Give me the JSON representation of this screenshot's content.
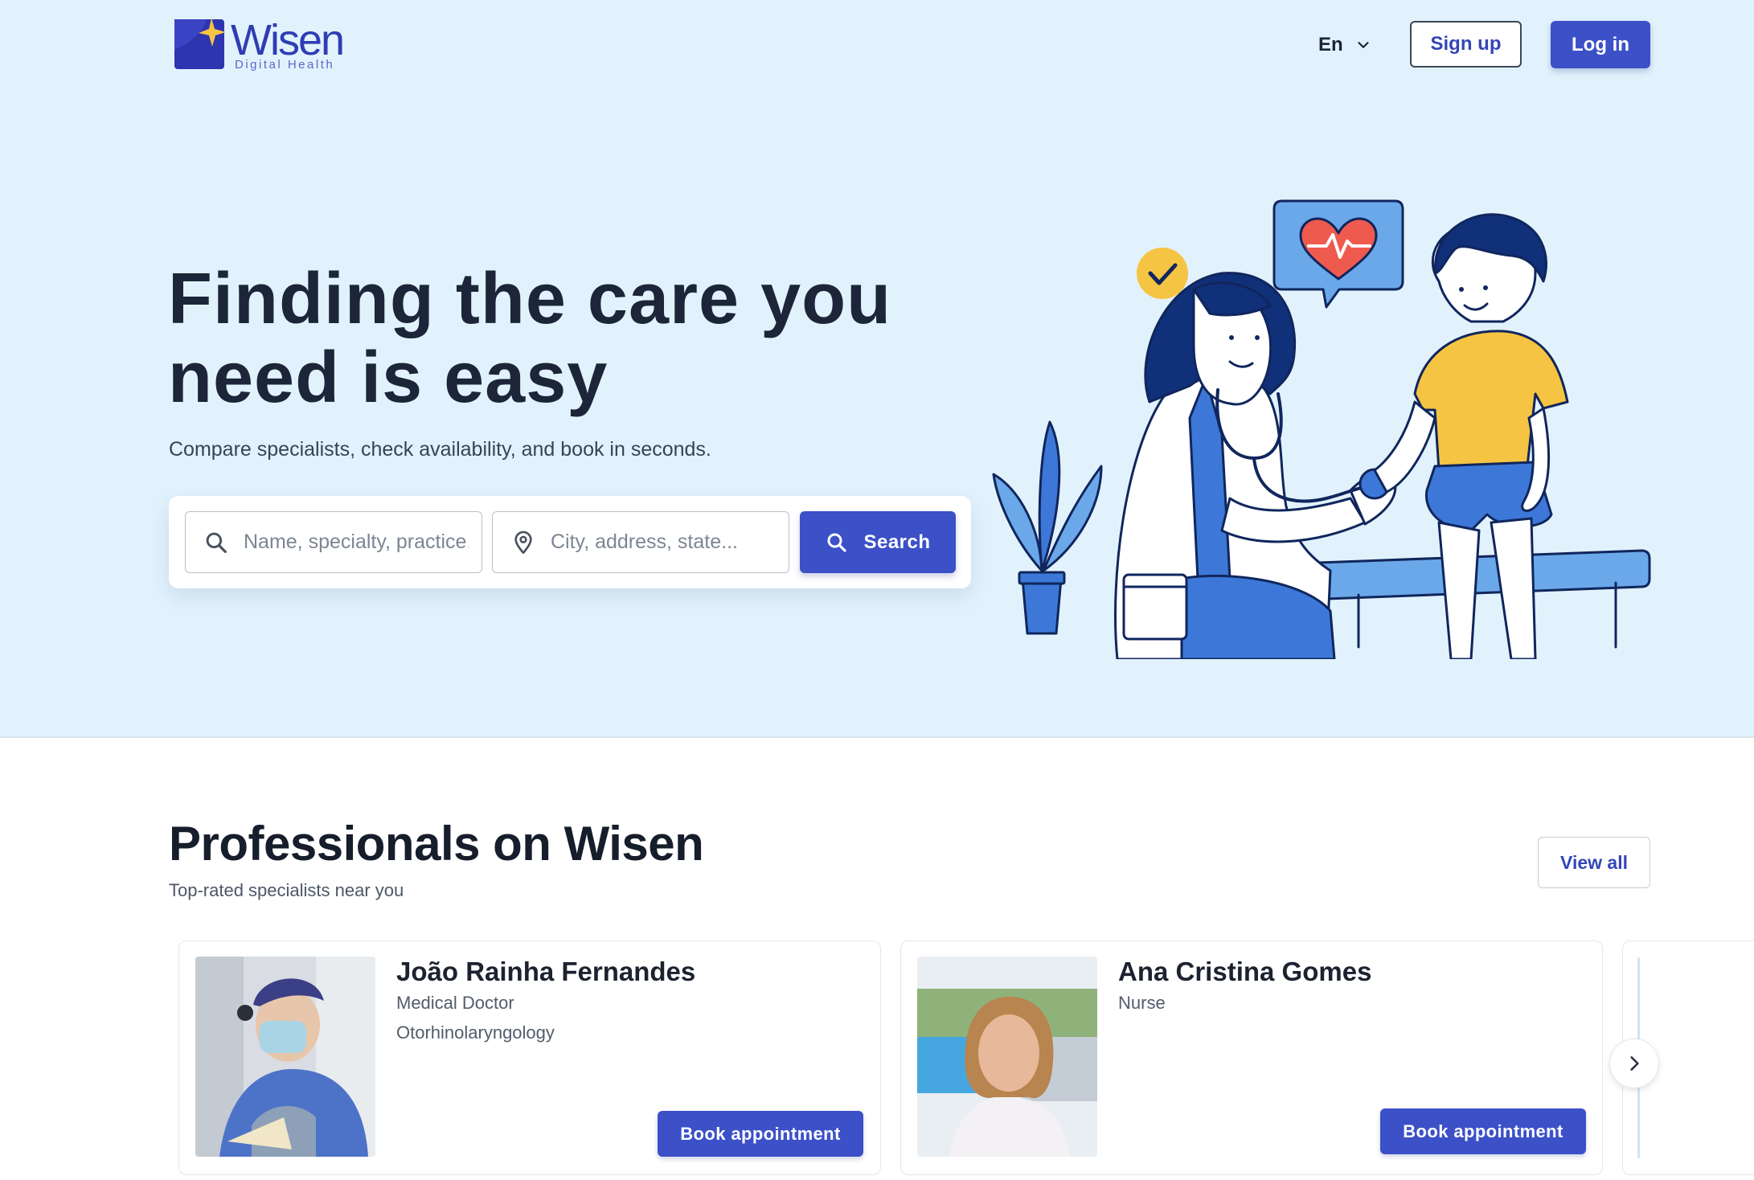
{
  "header": {
    "logo": {
      "word": "Wisen",
      "subtitle": "Digital Health"
    },
    "language": {
      "label": "En",
      "icon": "chevron-down-icon"
    },
    "signup_label": "Sign up",
    "login_label": "Log in"
  },
  "hero": {
    "title": "Finding the care you need is easy",
    "subtitle": "Compare specialists, check availability, and book in seconds.",
    "search": {
      "query_placeholder": "Name, specialty, practice...",
      "location_placeholder": "City, address, state...",
      "button_label": "Search",
      "query_icon": "search-icon",
      "location_icon": "map-pin-icon"
    },
    "illustration": "doctor-examining-child-illustration"
  },
  "professionals": {
    "title": "Professionals on Wisen",
    "subtitle": "Top-rated specialists near you",
    "view_all_label": "View all",
    "cards": [
      {
        "name": "João Rainha Fernandes",
        "role": "Medical Doctor",
        "specialty": "Otorhinolaryngology",
        "book_label": "Book appointment"
      },
      {
        "name": "Ana Cristina Gomes",
        "role": "Nurse",
        "specialty": "",
        "book_label": "Book appointment"
      }
    ],
    "next_icon": "chevron-right-icon"
  },
  "colors": {
    "primary": "#3c50c8",
    "hero_background": "#e2f2fd",
    "heading": "#1c2638",
    "accent_yellow": "#f6c443"
  }
}
